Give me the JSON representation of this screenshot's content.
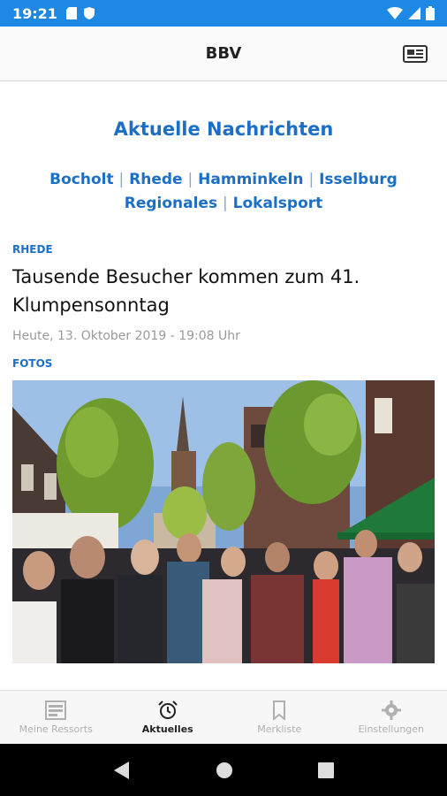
{
  "status_bar": {
    "time": "19:21",
    "left_icons": [
      "sim-card-icon",
      "shield-icon"
    ],
    "right_icons": [
      "wifi-icon",
      "signal-icon",
      "battery-icon"
    ]
  },
  "app_bar": {
    "title": "BBV",
    "action_icon": "newspaper-icon"
  },
  "main": {
    "section_title": "Aktuelle Nachrichten",
    "nav_links": [
      {
        "label": "Bocholt"
      },
      {
        "label": "Rhede"
      },
      {
        "label": "Hamminkeln"
      },
      {
        "label": "Isselburg"
      },
      {
        "label": "Regionales"
      },
      {
        "label": "Lokalsport"
      }
    ],
    "separator": "|",
    "article": {
      "category": "RHEDE",
      "headline": "Tausende Besucher kommen zum 41. Klumpensonntag",
      "date": "Heute, 13. Oktober 2019 - 19:08 Uhr",
      "media_label": "FOTOS"
    }
  },
  "bottom_nav": {
    "items": [
      {
        "label": "Meine Ressorts",
        "icon": "sections-icon",
        "active": false
      },
      {
        "label": "Aktuelles",
        "icon": "alarm-clock-icon",
        "active": true
      },
      {
        "label": "Merkliste",
        "icon": "bookmark-icon",
        "active": false
      },
      {
        "label": "Einstellungen",
        "icon": "gear-icon",
        "active": false
      }
    ]
  },
  "system_nav": {
    "icons": [
      "back-icon",
      "home-icon",
      "recents-icon"
    ]
  },
  "colors": {
    "status_bar": "#1e88e5",
    "accent": "#1c6fc6",
    "muted": "#9a9a9a"
  }
}
